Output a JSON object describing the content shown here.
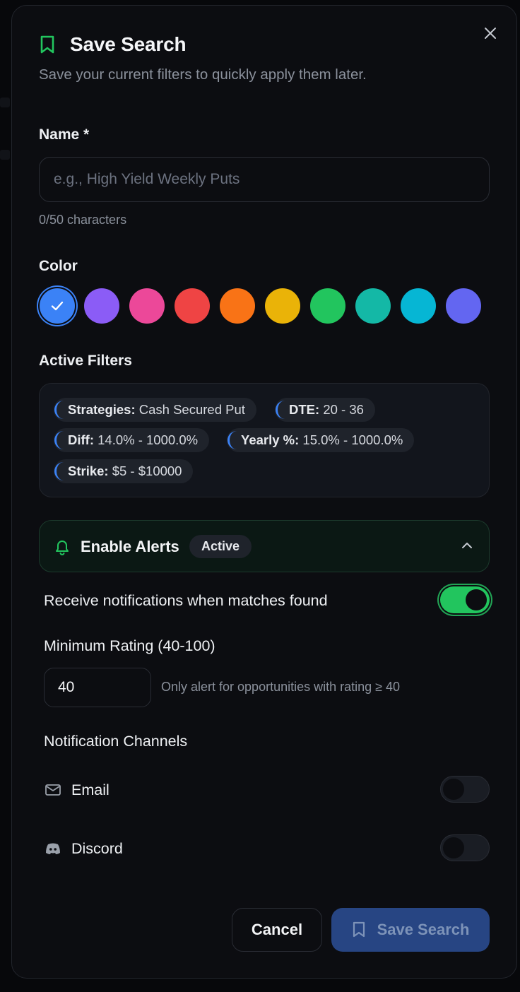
{
  "dialog": {
    "title": "Save Search",
    "subtitle": "Save your current filters to quickly apply them later."
  },
  "name_field": {
    "label": "Name *",
    "value": "",
    "placeholder": "e.g., High Yield Weekly Puts",
    "char_count": "0/50 characters"
  },
  "color": {
    "label": "Color",
    "selected": "#3b82f6",
    "options": [
      "#3b82f6",
      "#8b5cf6",
      "#ec4899",
      "#ef4444",
      "#f97316",
      "#eab308",
      "#22c55e",
      "#14b8a6",
      "#06b6d4",
      "#6366f1"
    ]
  },
  "active_filters": {
    "label": "Active Filters",
    "chips": [
      {
        "key": "Strategies:",
        "value": "Cash Secured Put"
      },
      {
        "key": "DTE:",
        "value": "20 - 36"
      },
      {
        "key": "Diff:",
        "value": "14.0% - 1000.0%"
      },
      {
        "key": "Yearly %:",
        "value": "15.0% - 1000.0%"
      },
      {
        "key": "Strike:",
        "value": "$5 - $10000"
      }
    ]
  },
  "alerts": {
    "title": "Enable Alerts",
    "badge": "Active",
    "expanded": true,
    "receive_label": "Receive notifications when matches found",
    "receive_enabled": true,
    "min_rating_label": "Minimum Rating (40-100)",
    "min_rating_value": "40",
    "min_rating_hint": "Only alert for opportunities with rating ≥ 40",
    "channels_label": "Notification Channels",
    "channels": [
      {
        "name": "Email",
        "icon": "mail-icon",
        "enabled": false
      },
      {
        "name": "Discord",
        "icon": "discord-icon",
        "enabled": false
      }
    ]
  },
  "actions": {
    "cancel": "Cancel",
    "save": "Save Search"
  }
}
